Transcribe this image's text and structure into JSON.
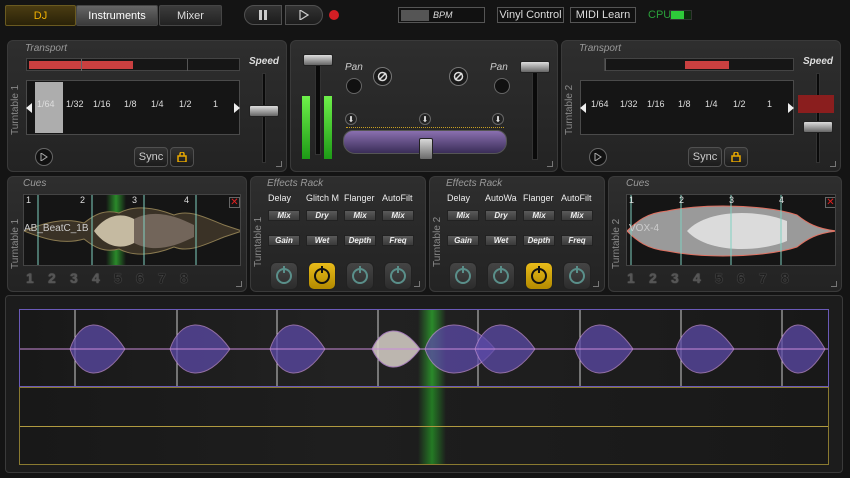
{
  "tabs": [
    {
      "label": "DJ",
      "active": true
    },
    {
      "label": "Instruments"
    },
    {
      "label": "Mixer"
    }
  ],
  "toolbar": {
    "pause_icon": "pause-icon",
    "play_icon": "play-icon",
    "record_icon": "record-icon",
    "bpm_label": "BPM",
    "vinyl_label": "Vinyl Control",
    "midi_label": "MIDI Learn",
    "cpu_label": "CPU",
    "cpu_level": 0.65
  },
  "transport_left": {
    "title": "Transport",
    "side_label": "Turntable 1",
    "loop_values": [
      "1/64",
      "1/32",
      "1/16",
      "1/8",
      "1/4",
      "1/2",
      "1"
    ],
    "sync_label": "Sync",
    "speed_label": "Speed"
  },
  "transport_right": {
    "title": "Transport",
    "side_label": "Turntable 2",
    "loop_values": [
      "1/64",
      "1/32",
      "1/16",
      "1/8",
      "1/4",
      "1/2",
      "1"
    ],
    "sync_label": "Sync",
    "speed_label": "Speed"
  },
  "mixer": {
    "pan_left": "Pan",
    "pan_right": "Pan"
  },
  "cues_left": {
    "title": "Cues",
    "side_label": "Turntable 1",
    "track_name": "AB_BeatC_1B",
    "markers": [
      "1",
      "2",
      "3",
      "4"
    ],
    "numbers": [
      "1",
      "2",
      "3",
      "4",
      "5",
      "6",
      "7",
      "8"
    ]
  },
  "cues_right": {
    "title": "Cues",
    "side_label": "Turntable 2",
    "track_name": "VOX-4",
    "markers": [
      "1",
      "2",
      "3",
      "4"
    ],
    "numbers": [
      "1",
      "2",
      "3",
      "4",
      "5",
      "6",
      "7",
      "8"
    ]
  },
  "fx_left": {
    "title": "Effects Rack",
    "side_label": "Turntable 1",
    "columns": [
      {
        "name": "Delay",
        "b1": "Mix",
        "b2": "Gain"
      },
      {
        "name": "Glitch M",
        "b1": "Dry",
        "b2": "Wet"
      },
      {
        "name": "Flanger",
        "b1": "Mix",
        "b2": "Depth"
      },
      {
        "name": "AutoFilt",
        "b1": "Mix",
        "b2": "Freq"
      }
    ]
  },
  "fx_right": {
    "title": "Effects Rack",
    "side_label": "Turntable 2",
    "columns": [
      {
        "name": "Delay",
        "b1": "Mix",
        "b2": "Gain"
      },
      {
        "name": "AutoWa",
        "b1": "Dry",
        "b2": "Wet"
      },
      {
        "name": "Flanger",
        "b1": "Mix",
        "b2": "Depth"
      },
      {
        "name": "AutoFilt",
        "b1": "Mix",
        "b2": "Freq"
      }
    ]
  }
}
